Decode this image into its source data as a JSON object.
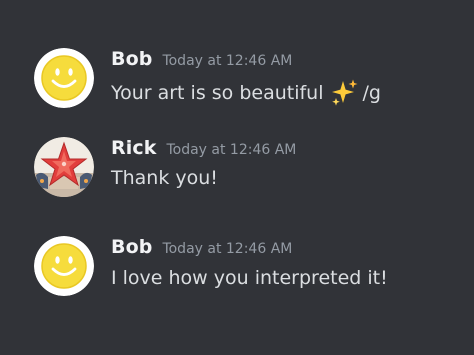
{
  "messages": [
    {
      "username": "Bob",
      "timestamp": "Today at 12:46 AM",
      "text_before": "Your art is so beautiful",
      "emoji": "sparkles-icon",
      "text_after": "/g"
    },
    {
      "username": "Rick",
      "timestamp": "Today at 12:46 AM",
      "text": "Thank you!"
    },
    {
      "username": "Bob",
      "timestamp": "Today at 12:46 AM",
      "text": "I love how you interpreted it!"
    }
  ],
  "colors": {
    "background": "#313338",
    "username": "#f2f3f5",
    "timestamp": "#949ba4",
    "message_text": "#dbdee1"
  }
}
